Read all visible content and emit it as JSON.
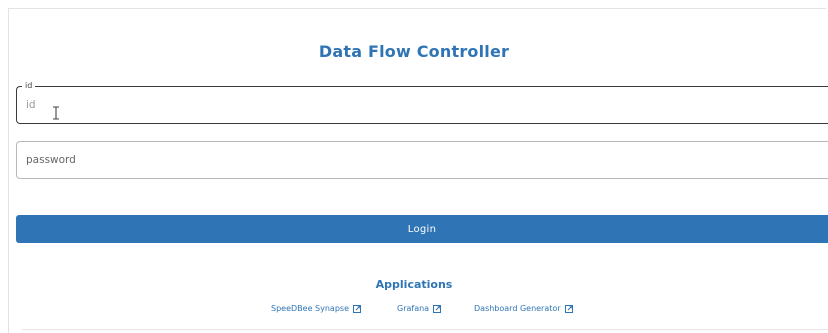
{
  "header": {
    "title": "Data Flow Controller"
  },
  "login_form": {
    "id_field": {
      "legend": "id",
      "placeholder": "id",
      "value": ""
    },
    "password_field": {
      "placeholder": "password",
      "value": ""
    },
    "login_label": "Login"
  },
  "applications": {
    "heading": "Applications",
    "links": [
      {
        "label": "SpeeDBee Synapse",
        "icon": "external-link-icon"
      },
      {
        "label": "Grafana",
        "icon": "external-link-icon"
      },
      {
        "label": "Dashboard Generator",
        "icon": "external-link-icon"
      }
    ]
  },
  "colors": {
    "accent": "#2f75b5",
    "button_text": "#ffffff"
  }
}
